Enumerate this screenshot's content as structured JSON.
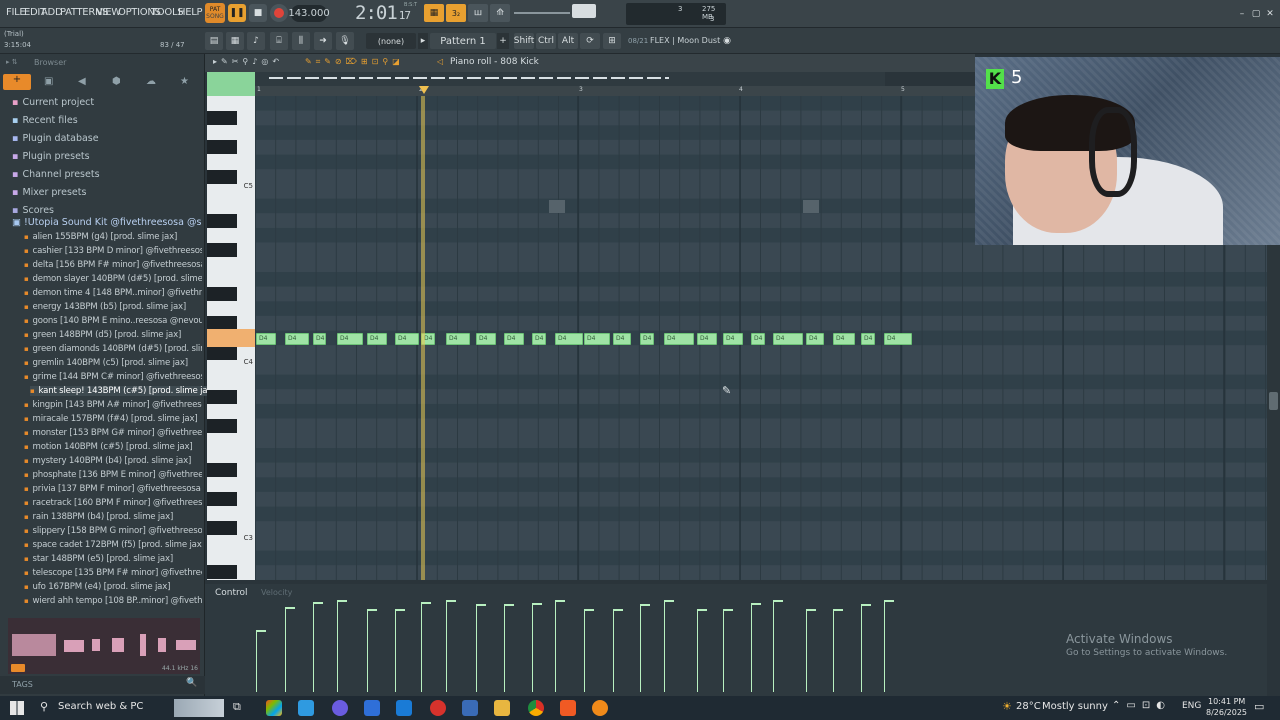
{
  "menu": [
    "FILE",
    "EDIT",
    "ADD",
    "PATTERNS",
    "VIEW",
    "OPTIONS",
    "TOOLS",
    "HELP"
  ],
  "transport": {
    "pat_label": "PAT",
    "song_label": "SONG",
    "tempo": "143.000",
    "time": "2:01",
    "time_small": "17",
    "time_unit": "B:S:T",
    "mem": "275 MB",
    "cpu": "3",
    "poly": "3"
  },
  "hint": {
    "trial": "(Trial)",
    "pos": "3:15:04",
    "cpu": "83 / 47"
  },
  "toolbar2": {
    "channel": "(none)",
    "pattern": "Pattern 1",
    "shift": "Shift",
    "ctrl": "Ctrl",
    "alt": "Alt",
    "news": "08/21",
    "news_text": "FLEX | Moon Dust"
  },
  "browser": {
    "title": "Browser",
    "sections": [
      "Current project",
      "Recent files",
      "Plugin database",
      "Plugin presets",
      "Channel presets",
      "Mixer presets",
      "Scores"
    ],
    "folder": "!Utopia Sound Kit @fivethreesosa @slimejax",
    "files": [
      "alien 155BPM (g4) [prod. slime jax]",
      "cashier [133 BPM D minor] @fivethreesosa",
      "delta [156 BPM F# minor] @fivethreesosa",
      "demon slayer 140BPM (d#5) [prod. slime jax]",
      "demon time 4 [148 BPM..minor] @fivethreesosa",
      "energy 143BPM (b5) [prod. slime jax]",
      "goons [140 BPM E mino..reesosa @nevoutrippin'",
      "green 148BPM (d5) [prod. slime jax]",
      "green diamonds 140BPM (d#5) [prod. slime jax]",
      "gremlin 140BPM (c5) [prod. slime jax]",
      "grime [144 BPM C# minor] @fivethreesosa",
      "kant sleep! 143BPM (c#5) [prod. slime jax]",
      "kingpin [143 BPM A# minor] @fivethreesosa",
      "miracale 157BPM (f#4) [prod. slime jax]",
      "monster [153 BPM G# minor] @fivethreesosa",
      "motion 140BPM (c#5) [prod. slime jax]",
      "mystery 140BPM (b4) [prod. slime jax]",
      "phosphate [136 BPM E minor] @fivethreesosa",
      "privia [137 BPM F minor] @fivethreesosa",
      "racetrack [160 BPM F minor] @fivethreesosa",
      "rain 138BPM (b4) [prod. slime jax]",
      "slippery [158 BPM G minor] @fivethreesosa",
      "space cadet 172BPM (f5) [prod. slime jax]",
      "star 148BPM (e5) [prod. slime jax]",
      "telescope [135 BPM F# minor] @fivethreesosa",
      "ufo 167BPM (e4) [prod. slime jax]",
      "wierd ahh tempo [108 BP..minor] @fivethreesosa"
    ],
    "sample_info": "44.1 kHz 16",
    "tags": "TAGS"
  },
  "pianoroll": {
    "title": "Piano roll - 808 Kick",
    "bars": [
      "1",
      "2",
      "3",
      "4",
      "5"
    ],
    "keys": [
      "C5",
      "C4",
      "C3"
    ],
    "note_label": "D4",
    "control": "Control",
    "control_sub": "Velocity"
  },
  "webcam": {
    "badge": "5"
  },
  "watermark": {
    "title": "Activate Windows",
    "sub": "Go to Settings to activate Windows."
  },
  "taskbar": {
    "search": "Search web & PC",
    "weather": "28°C",
    "weather_desc": "Mostly sunny",
    "lang": "ENG",
    "time": "10:41 PM",
    "date": "8/26/2025"
  }
}
